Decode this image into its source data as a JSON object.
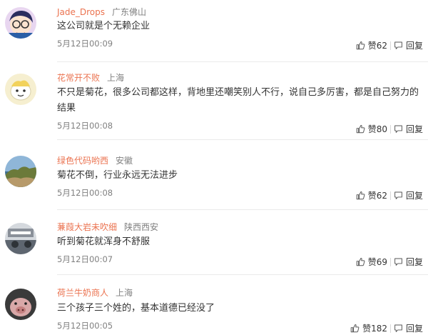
{
  "comments": [
    {
      "username": "Jade_Drops",
      "location": "广东佛山",
      "text": "这公司就是个无赖企业",
      "time": "5月12日00:09",
      "likes": "赞62",
      "reply": "回复"
    },
    {
      "username": "花常开不败",
      "location": "上海",
      "text": "不只是菊花，很多公司都这样，背地里还嘲笑别人不行，说自己多厉害，都是自己努力的结果",
      "time": "5月12日00:08",
      "likes": "赞80",
      "reply": "回复"
    },
    {
      "username": "绿色代码哟西",
      "location": "安徽",
      "text": "菊花不倒，行业永远无法进步",
      "time": "5月12日00:08",
      "likes": "赞62",
      "reply": "回复"
    },
    {
      "username": "蒹葭大岩未吹细",
      "location": "陕西西安",
      "text": "听到菊花就浑身不舒服",
      "time": "5月12日00:07",
      "likes": "赞69",
      "reply": "回复"
    },
    {
      "username": "荷兰牛奶商人",
      "location": "上海",
      "text": "三个孩子三个姓的，基本道德已经没了",
      "time": "5月12日00:05",
      "likes": "赞182",
      "reply": "回复"
    }
  ],
  "icons": {
    "like": "thumbs-up-icon",
    "reply": "reply-icon"
  },
  "colors": {
    "username": "#eb7350",
    "meta": "#808080",
    "text": "#333333"
  }
}
